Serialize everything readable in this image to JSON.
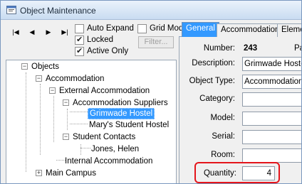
{
  "window": {
    "title": "Object Maintenance"
  },
  "toolbar": {
    "nav_first": "|◀",
    "nav_prev": "◀",
    "nav_next": "▶",
    "nav_last": "▶|",
    "auto_expand": {
      "label": "Auto Expand",
      "checked": false
    },
    "grid_mode": {
      "label": "Grid Mod",
      "checked": false
    },
    "locked": {
      "label": "Locked",
      "checked": true
    },
    "active_only": {
      "label": "Active Only",
      "checked": true
    },
    "filter_label": "Filter..."
  },
  "tree": {
    "items": [
      {
        "label": "Objects",
        "expander": "−"
      },
      {
        "label": "Accommodation",
        "expander": "−"
      },
      {
        "label": "External Accommodation",
        "expander": "−"
      },
      {
        "label": "Accommodation Suppliers",
        "expander": "−"
      },
      {
        "label": "Grimwade Hostel",
        "selected": true
      },
      {
        "label": "Mary's Student Hostel"
      },
      {
        "label": "Student Contacts",
        "expander": "−"
      },
      {
        "label": "Jones, Helen"
      },
      {
        "label": "Internal Accommodation"
      },
      {
        "label": "Main Campus",
        "expander": "+"
      }
    ]
  },
  "tabs": [
    {
      "label": "General",
      "active": true
    },
    {
      "label": "Accommodation",
      "active": false
    },
    {
      "label": "Eleme",
      "active": false
    }
  ],
  "form": {
    "number_label": "Number:",
    "number_value": "243",
    "trailing_label": "Pa",
    "description_label": "Description:",
    "description_value": "Grimwade Hostel",
    "object_type_label": "Object Type:",
    "object_type_value": "Accommodation",
    "category_label": "Category:",
    "category_value": "",
    "model_label": "Model:",
    "model_value": "",
    "serial_label": "Serial:",
    "serial_value": "",
    "room_label": "Room:",
    "room_value": "",
    "quantity_label": "Quantity:",
    "quantity_value": "4"
  },
  "colors": {
    "highlight": "#e4151b",
    "selection": "#3399ff"
  }
}
